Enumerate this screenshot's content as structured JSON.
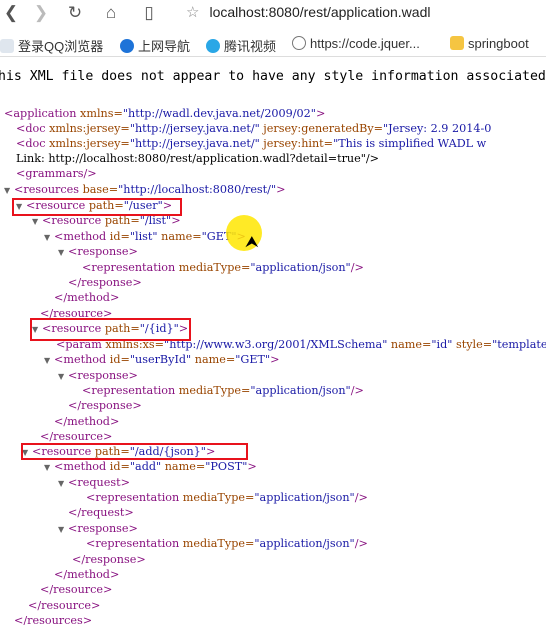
{
  "browser": {
    "url": "localhost:8080/rest/application.wadl",
    "bookmarks": [
      {
        "label": "登录QQ浏览器"
      },
      {
        "label": "上网导航"
      },
      {
        "label": "腾讯视频"
      },
      {
        "label": "https://code.jquer..."
      },
      {
        "label": "springboot"
      }
    ],
    "message": "his XML file does not appear to have any style information associated with it."
  },
  "xml": {
    "l1": {
      "tag": "<application",
      "a1": " xmlns=",
      "v1": "\"http://wadl.dev.java.net/2009/02\"",
      "end": ">"
    },
    "l2": {
      "tag": "<doc",
      "a1": " xmlns:jersey=",
      "v1": "\"http://jersey.java.net/\"",
      "a2": " jersey:generatedBy=",
      "v2": "\"Jersey: 2.9 2014-0"
    },
    "l3": {
      "tag": "<doc",
      "a1": " xmlns:jersey=",
      "v1": "\"http://jersey.java.net/\"",
      "a2": " jersey:hint=",
      "v2": "\"This is simplified WADL w"
    },
    "l4": {
      "text": "Link: http://localhost:8080/rest/application.wadl?detail=true\"/>"
    },
    "l5": {
      "tag": "<grammars/>"
    },
    "l6": {
      "tag": "<resources",
      "a1": " base=",
      "v1": "\"http://localhost:8080/rest/\"",
      "end": ">"
    },
    "l7": {
      "tag": "<resource",
      "a1": " path=",
      "v1": "\"/user\"",
      "end": ">"
    },
    "l8": {
      "tag": "<resource",
      "a1": " path=",
      "v1": "\"/list\"",
      "end": ">"
    },
    "l9": {
      "tag": "<method",
      "a1": " id=",
      "v1": "\"list\"",
      "a2": " name=",
      "v2": "\"GET\"",
      "end": ">"
    },
    "l10": {
      "tag": "<response>"
    },
    "l11": {
      "tag": "<representation",
      "a1": " mediaType=",
      "v1": "\"application/json\"",
      "end": "/>"
    },
    "l12": {
      "tag": "</response>"
    },
    "l13": {
      "tag": "</method>"
    },
    "l14": {
      "tag": "</resource>"
    },
    "l15": {
      "tag": "<resource",
      "a1": " path=",
      "v1": "\"/{id}\"",
      "end": ">"
    },
    "l16": {
      "tag": "<param",
      "a1": " xmlns:xs=",
      "v1": "\"http://www.w3.org/2001/XMLSchema\"",
      "a2": " name=",
      "v2": "\"id\"",
      "a3": " style=",
      "v3": "\"template"
    },
    "l17": {
      "tag": "<method",
      "a1": " id=",
      "v1": "\"userById\"",
      "a2": " name=",
      "v2": "\"GET\"",
      "end": ">"
    },
    "l18": {
      "tag": "<response>"
    },
    "l19": {
      "tag": "<representation",
      "a1": " mediaType=",
      "v1": "\"application/json\"",
      "end": "/>"
    },
    "l20": {
      "tag": "</response>"
    },
    "l21": {
      "tag": "</method>"
    },
    "l22": {
      "tag": "</resource>"
    },
    "l23": {
      "tag": "<resource",
      "a1": " path=",
      "v1": "\"/add/{json}\"",
      "end": ">"
    },
    "l24": {
      "tag": "<method",
      "a1": " id=",
      "v1": "\"add\"",
      "a2": " name=",
      "v2": "\"POST\"",
      "end": ">"
    },
    "l25": {
      "tag": "<request>"
    },
    "l26": {
      "tag": "<representation",
      "a1": " mediaType=",
      "v1": "\"application/json\"",
      "end": "/>"
    },
    "l27": {
      "tag": "</request>"
    },
    "l28": {
      "tag": "<response>"
    },
    "l29": {
      "tag": "<representation",
      "a1": " mediaType=",
      "v1": "\"application/json\"",
      "end": "/>"
    },
    "l30": {
      "tag": "</response>"
    },
    "l31": {
      "tag": "</method>"
    },
    "l32": {
      "tag": "</resource>"
    },
    "l33": {
      "tag": "</resource>"
    },
    "l34": {
      "tag": "</resources>"
    }
  }
}
